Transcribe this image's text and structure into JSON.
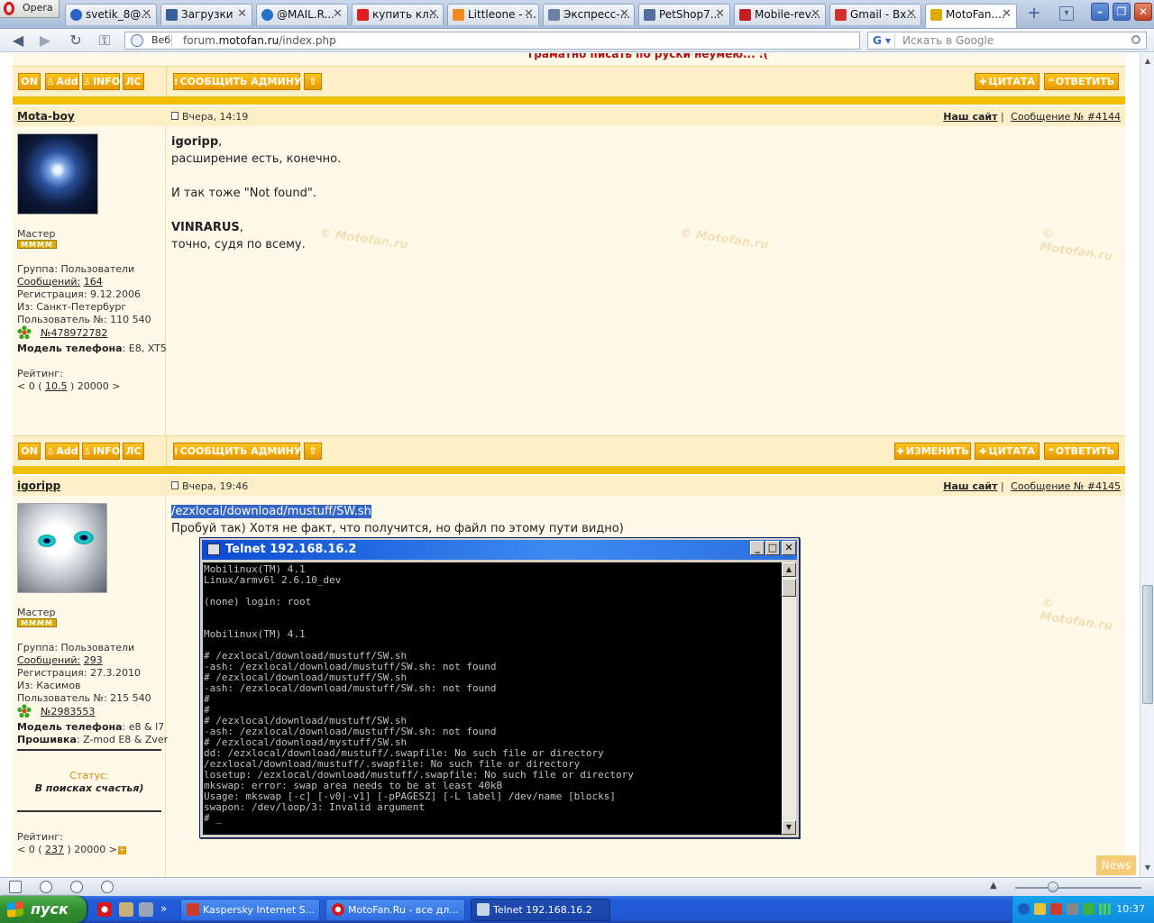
{
  "browser": {
    "app_name": "Opera",
    "tabs": [
      {
        "label": "svetik_8@...",
        "color": "#2f62c6"
      },
      {
        "label": "Загрузки",
        "color": "#3b5f9a"
      },
      {
        "label": "@MAIL.R...",
        "color": "#2570c6"
      },
      {
        "label": "купить кл...",
        "color": "#e02020"
      },
      {
        "label": "Littleone - ...",
        "color": "#f08a1c"
      },
      {
        "label": "Экспресс-...",
        "color": "#6b7fa0"
      },
      {
        "label": "PetShop7...",
        "color": "#4f6f9f"
      },
      {
        "label": "Mobile-rev...",
        "color": "#c02020"
      },
      {
        "label": "Gmail - Вх...",
        "color": "#d03030"
      },
      {
        "label": "MotoFan....",
        "color": "#e0a800",
        "active": true
      }
    ],
    "address": {
      "web_label": "Веб",
      "url_prefix": "forum.",
      "url_domain": "motofan.ru",
      "url_path": "/index.php"
    },
    "search_placeholder": "Искать в Google",
    "search_engine": "G"
  },
  "page": {
    "top_cut_text": "граматно писать по руски неумею... :(",
    "buttons": {
      "on": "ON",
      "add": "Add",
      "info": "INFO",
      "ls": "ЛС",
      "report": "СООБЩИТЬ АДМИНУ",
      "edit": "ИЗМЕНИТЬ",
      "quote": "ЦИТАТА",
      "reply": "ОТВЕТИТЬ"
    },
    "watermark": "Motofan.ru",
    "posts": [
      {
        "author": "Mota-boy",
        "date": "Вчера, 14:19",
        "site_label": "Наш сайт",
        "msg_prefix": "Сообщение №",
        "msg_num": "#4144",
        "rank": "Мастер",
        "stars": "MMMM",
        "group": "Группа: Пользователи",
        "posts_label": "Сообщений:",
        "posts_count": "164",
        "reg": "Регистрация: 9.12.2006",
        "from": "Из: Санкт-Петербург",
        "user_no": "Пользователь №: 110 540",
        "icq": "№478972782",
        "phone_label": "Модель телефона",
        "phone": ": E8, XT5",
        "rating_label": "Рейтинг:",
        "rating_pre": "< 0 (",
        "rating_val": "10.5",
        "rating_post": ") 20000 >",
        "lines": [
          {
            "b": "igoripp",
            "t": ","
          },
          {
            "b": "",
            "t": "расширение есть, конечно."
          },
          {
            "b": "",
            "t": ""
          },
          {
            "b": "",
            "t": "И так тоже \"Not found\"."
          },
          {
            "b": "",
            "t": ""
          },
          {
            "b": "VINRARUS",
            "t": ","
          },
          {
            "b": "",
            "t": "точно, судя по всему."
          }
        ]
      },
      {
        "author": "igoripp",
        "date": "Вчера, 19:46",
        "site_label": "Наш сайт",
        "msg_prefix": "Сообщение №",
        "msg_num": "#4145",
        "rank": "Мастер",
        "stars": "MMMM",
        "group": "Группа: Пользователи",
        "posts_label": "Сообщений:",
        "posts_count": "293",
        "reg": "Регистрация: 27.3.2010",
        "from": "Из: Касимов",
        "user_no": "Пользователь №: 215 540",
        "icq": "№2983553",
        "phone_label": "Модель телефона",
        "phone": ": e8 & l7",
        "firmware_label": "Прошивка",
        "firmware": ": Z-mod E8 & Zver",
        "status_label": "Статус:",
        "status": "В поисках счастья)",
        "rating_label": "Рейтинг:",
        "rating_pre": "< 0 (",
        "rating_val": "237",
        "rating_post": ") 20000 >",
        "highlight": "/ezxlocal/download/mustuff/SW.sh",
        "line2": "Пробуй так) Хотя не факт, что получится, но файл по этому пути видно)"
      }
    ]
  },
  "telnet": {
    "title": "Telnet 192.168.16.2",
    "output": "Mobilinux(TM) 4.1\nLinux/armv6l 2.6.10_dev\n\n(none) login: root\n\n\nMobilinux(TM) 4.1\n\n# /ezxlocal/download/mustuff/SW.sh\n-ash: /ezxlocal/download/mustuff/SW.sh: not found\n# /ezxlocal/download/mustuff/SW.sh\n-ash: /ezxlocal/download/mustuff/SW.sh: not found\n#\n#\n# /ezxlocal/download/mustuff/SW.sh\n-ash: /ezxlocal/download/mustuff/SW.sh: not found\n# /ezxlocal/download/mystuff/SW.sh\ndd: /ezxlocal/download/mustuff/.swapfile: No such file or directory\n/ezxlocal/download/mustuff/.swapfile: No such file or directory\nlosetup: /ezxlocal/download/mustuff/.swapfile: No such file or directory\nmkswap: error: swap area needs to be at least 40kB\nUsage: mkswap [-c] [-v0|-v1] [-pPAGESZ] [-L label] /dev/name [blocks]\nswapon: /dev/loop/3: Invalid argument\n# _"
  },
  "statusbar": {
    "news": "News"
  },
  "taskbar": {
    "start": "пуск",
    "tasks": [
      {
        "label": "Kaspersky Internet S...",
        "color": "#d03a2a"
      },
      {
        "label": "MotoFan.Ru - все дл...",
        "color": "#d21a1a"
      },
      {
        "label": "Telnet 192.168.16.2",
        "color": "#c8d4e6",
        "active": true
      }
    ],
    "clock": "10:37"
  }
}
